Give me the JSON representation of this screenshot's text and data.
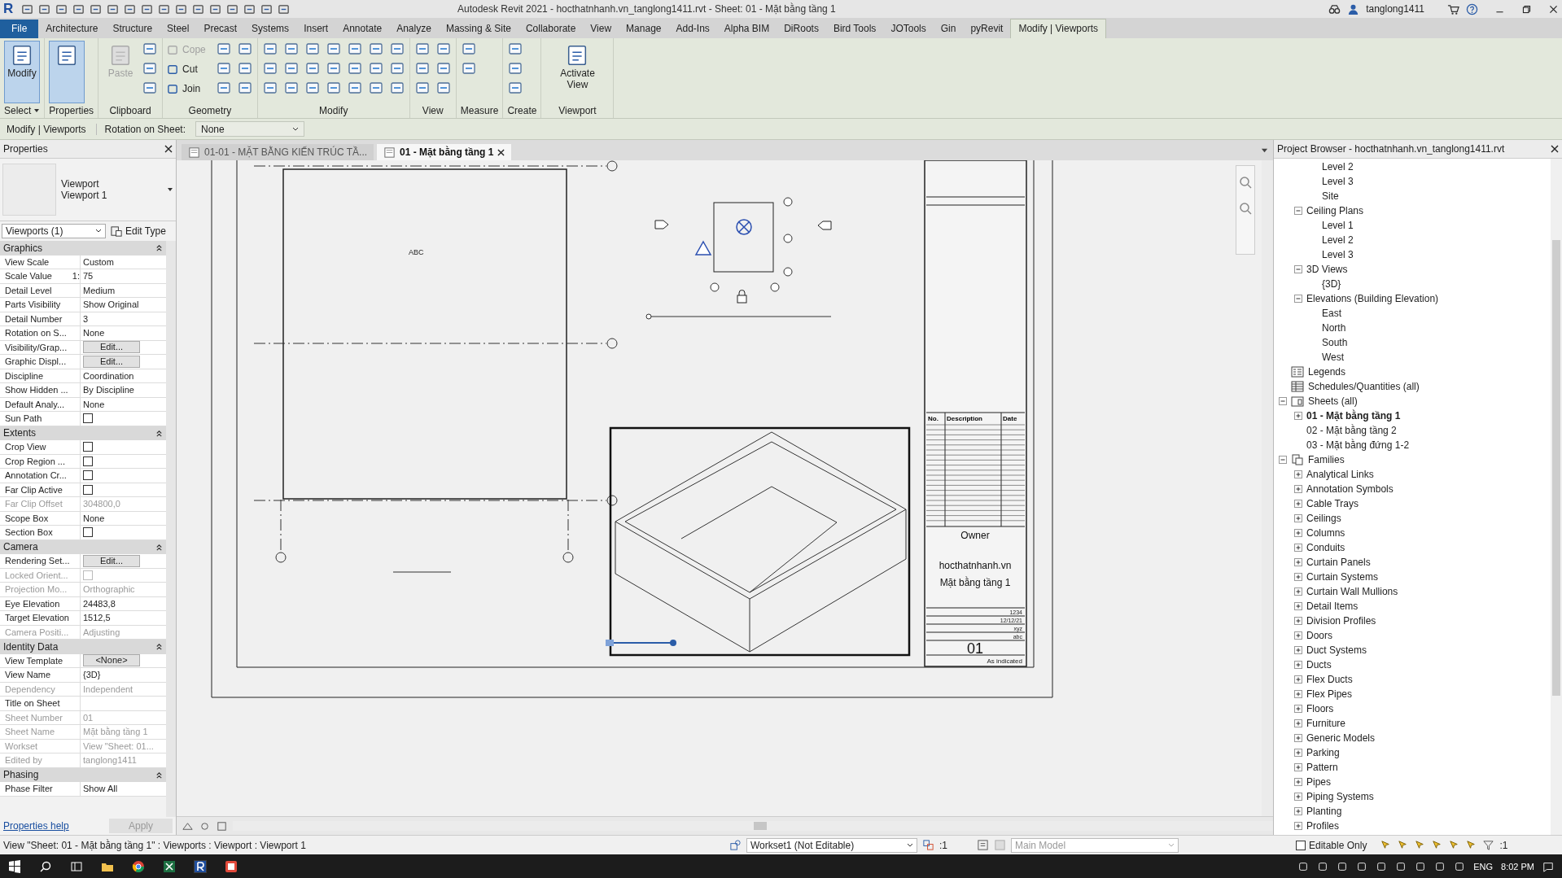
{
  "window": {
    "app_logo": "R",
    "title": "Autodesk Revit 2021 - hocthatnhanh.vn_tanglong1411.rvt - Sheet: 01 - Mặt bằng tầng 1",
    "user": "tanglong1411"
  },
  "ribbon_tabs": [
    {
      "label": "File",
      "kind": "file",
      "selected": false
    },
    {
      "label": "Architecture",
      "kind": "tab",
      "selected": false
    },
    {
      "label": "Structure",
      "kind": "tab",
      "selected": false
    },
    {
      "label": "Steel",
      "kind": "tab",
      "selected": false
    },
    {
      "label": "Precast",
      "kind": "tab",
      "selected": false
    },
    {
      "label": "Systems",
      "kind": "tab",
      "selected": false
    },
    {
      "label": "Insert",
      "kind": "tab",
      "selected": false
    },
    {
      "label": "Annotate",
      "kind": "tab",
      "selected": false
    },
    {
      "label": "Analyze",
      "kind": "tab",
      "selected": false
    },
    {
      "label": "Massing & Site",
      "kind": "tab",
      "selected": false
    },
    {
      "label": "Collaborate",
      "kind": "tab",
      "selected": false
    },
    {
      "label": "View",
      "kind": "tab",
      "selected": false
    },
    {
      "label": "Manage",
      "kind": "tab",
      "selected": false
    },
    {
      "label": "Add-Ins",
      "kind": "tab",
      "selected": false
    },
    {
      "label": "Alpha BIM",
      "kind": "tab",
      "selected": false
    },
    {
      "label": "DiRoots",
      "kind": "tab",
      "selected": false
    },
    {
      "label": "Bird Tools",
      "kind": "tab",
      "selected": false
    },
    {
      "label": "JOTools",
      "kind": "tab",
      "selected": false
    },
    {
      "label": "Gin",
      "kind": "tab",
      "selected": false
    },
    {
      "label": "pyRevit",
      "kind": "tab",
      "selected": false
    },
    {
      "label": "Modify | Viewports",
      "kind": "tab",
      "selected": true
    }
  ],
  "ribbon_panels": [
    {
      "label": "Select",
      "dropdown": true,
      "tools": [
        {
          "kind": "large",
          "label": "Modify",
          "selected": true,
          "disabled": false
        }
      ]
    },
    {
      "label": "Properties",
      "tools": [
        {
          "kind": "large",
          "selected": true,
          "disabled": false
        }
      ]
    },
    {
      "label": "Clipboard",
      "tools": [
        {
          "kind": "large",
          "label": "Paste",
          "selected": false,
          "disabled": true
        },
        {
          "kind": "icon"
        },
        {
          "kind": "icon"
        },
        {
          "kind": "icon"
        }
      ]
    },
    {
      "label": "Geometry",
      "tools": [
        {
          "kind": "small",
          "label": "Cope",
          "disabled": true
        },
        {
          "kind": "small",
          "label": "Cut",
          "disabled": false
        },
        {
          "kind": "small",
          "label": "Join",
          "disabled": false
        },
        {
          "kind": "icon"
        },
        {
          "kind": "icon"
        },
        {
          "kind": "icon"
        },
        {
          "kind": "icon"
        },
        {
          "kind": "icon"
        },
        {
          "kind": "icon"
        }
      ]
    },
    {
      "label": "Modify",
      "tools": [
        {
          "kind": "icon"
        },
        {
          "kind": "icon"
        },
        {
          "kind": "icon"
        },
        {
          "kind": "icon"
        },
        {
          "kind": "icon"
        },
        {
          "kind": "icon"
        },
        {
          "kind": "icon"
        },
        {
          "kind": "icon"
        },
        {
          "kind": "icon"
        },
        {
          "kind": "icon"
        },
        {
          "kind": "icon"
        },
        {
          "kind": "icon"
        },
        {
          "kind": "icon"
        },
        {
          "kind": "icon"
        },
        {
          "kind": "icon"
        },
        {
          "kind": "icon"
        },
        {
          "kind": "icon"
        },
        {
          "kind": "icon"
        },
        {
          "kind": "icon"
        },
        {
          "kind": "icon"
        },
        {
          "kind": "icon"
        }
      ]
    },
    {
      "label": "View",
      "tools": [
        {
          "kind": "icon"
        },
        {
          "kind": "icon"
        },
        {
          "kind": "icon"
        },
        {
          "kind": "icon"
        },
        {
          "kind": "icon"
        },
        {
          "kind": "icon"
        }
      ]
    },
    {
      "label": "Measure",
      "tools": [
        {
          "kind": "icon"
        },
        {
          "kind": "icon"
        }
      ]
    },
    {
      "label": "Create",
      "tools": [
        {
          "kind": "icon"
        },
        {
          "kind": "icon"
        },
        {
          "kind": "icon"
        }
      ]
    },
    {
      "label": "Viewport",
      "tools": [
        {
          "kind": "large",
          "label": "Activate View",
          "selected": false,
          "disabled": false
        }
      ]
    }
  ],
  "options_bar": {
    "context": "Modify | Viewports",
    "rotation_label": "Rotation on Sheet:",
    "rotation_value": "None"
  },
  "properties": {
    "title": "Properties",
    "type_name": "Viewport",
    "type_subname": "Viewport 1",
    "selector": "Viewports (1)",
    "edit_type": "Edit Type",
    "sections": [
      {
        "label": "Graphics",
        "rows": [
          {
            "label": "View Scale",
            "value": "Custom",
            "kind": "text",
            "disabled": false
          },
          {
            "label": "Scale Value",
            "suffix": "1:",
            "value": "75",
            "kind": "text",
            "disabled": false
          },
          {
            "label": "Detail Level",
            "value": "Medium",
            "kind": "text",
            "disabled": false
          },
          {
            "label": "Parts Visibility",
            "value": "Show Original",
            "kind": "text",
            "disabled": false
          },
          {
            "label": "Detail Number",
            "value": "3",
            "kind": "text",
            "disabled": false
          },
          {
            "label": "Rotation on S...",
            "value": "None",
            "kind": "text",
            "disabled": false
          },
          {
            "label": "Visibility/Grap...",
            "value": "Edit...",
            "kind": "button",
            "disabled": false
          },
          {
            "label": "Graphic Displ...",
            "value": "Edit...",
            "kind": "button",
            "disabled": false
          },
          {
            "label": "Discipline",
            "value": "Coordination",
            "kind": "text",
            "disabled": false
          },
          {
            "label": "Show Hidden ...",
            "value": "By Discipline",
            "kind": "text",
            "disabled": false
          },
          {
            "label": "Default Analy...",
            "value": "None",
            "kind": "text",
            "disabled": false
          },
          {
            "label": "Sun Path",
            "kind": "checkbox",
            "checked": false,
            "disabled": false
          }
        ]
      },
      {
        "label": "Extents",
        "rows": [
          {
            "label": "Crop View",
            "kind": "checkbox",
            "checked": false,
            "disabled": false
          },
          {
            "label": "Crop Region ...",
            "kind": "checkbox",
            "checked": false,
            "disabled": false
          },
          {
            "label": "Annotation Cr...",
            "kind": "checkbox",
            "checked": false,
            "disabled": false
          },
          {
            "label": "Far Clip Active",
            "kind": "checkbox",
            "checked": false,
            "disabled": false
          },
          {
            "label": "Far Clip Offset",
            "value": "304800,0",
            "kind": "text",
            "disabled": true
          },
          {
            "label": "Scope Box",
            "value": "None",
            "kind": "text",
            "disabled": false
          },
          {
            "label": "Section Box",
            "kind": "checkbox",
            "checked": false,
            "disabled": false
          }
        ]
      },
      {
        "label": "Camera",
        "rows": [
          {
            "label": "Rendering Set...",
            "value": "Edit...",
            "kind": "button",
            "disabled": false
          },
          {
            "label": "Locked Orient...",
            "kind": "checkbox",
            "checked": false,
            "disabled": true
          },
          {
            "label": "Projection Mo...",
            "value": "Orthographic",
            "kind": "text",
            "disabled": true
          },
          {
            "label": "Eye Elevation",
            "value": "24483,8",
            "kind": "text",
            "disabled": false
          },
          {
            "label": "Target Elevation",
            "value": "1512,5",
            "kind": "text",
            "disabled": false
          },
          {
            "label": "Camera Positi...",
            "value": "Adjusting",
            "kind": "text",
            "disabled": true
          }
        ]
      },
      {
        "label": "Identity Data",
        "rows": [
          {
            "label": "View Template",
            "value": "<None>",
            "kind": "button",
            "disabled": false
          },
          {
            "label": "View Name",
            "value": "{3D}",
            "kind": "text",
            "disabled": false
          },
          {
            "label": "Dependency",
            "value": "Independent",
            "kind": "text",
            "disabled": true
          },
          {
            "label": "Title on Sheet",
            "kind": "text",
            "disabled": false
          },
          {
            "label": "Sheet Number",
            "value": "01",
            "kind": "text",
            "disabled": true
          },
          {
            "label": "Sheet Name",
            "value": "Mặt bằng tầng 1",
            "kind": "text",
            "disabled": true
          },
          {
            "label": "Workset",
            "value": "View \"Sheet: 01...",
            "kind": "text",
            "disabled": true
          },
          {
            "label": "Edited by",
            "value": "tanglong1411",
            "kind": "text",
            "disabled": true
          }
        ]
      },
      {
        "label": "Phasing",
        "rows": [
          {
            "label": "Phase Filter",
            "value": "Show All",
            "kind": "text",
            "disabled": false
          }
        ]
      }
    ],
    "help_link": "Properties help",
    "apply": "Apply"
  },
  "view_tabs": [
    {
      "label": "01-01 - MẶT BẰNG KIẾN TRÚC TẦ...",
      "selected": false
    },
    {
      "label": "01 - Mặt bằng tầng 1",
      "selected": true
    }
  ],
  "sheet": {
    "viewport_label": "ABC",
    "title_block": {
      "revision_headers": [
        "No.",
        "Description",
        "Date"
      ],
      "owner": "Owner",
      "project": "hocthatnhanh.vn",
      "sheet_name": "Mặt bằng tầng 1",
      "fields": [
        "1234",
        "12/12/21",
        "xyz",
        "abc"
      ],
      "sheet_number": "01",
      "scale": "As indicated"
    }
  },
  "project_browser": {
    "title": "Project Browser - hocthatnhanh.vn_tanglong1411.rvt",
    "tree": [
      {
        "children": [
          {
            "children": [
              {
                "label": "Level 2"
              },
              {
                "label": "Level 3"
              },
              {
                "label": "Site"
              }
            ]
          },
          {
            "label": "Ceiling Plans",
            "expanded": true,
            "children": [
              {
                "label": "Level 1"
              },
              {
                "label": "Level 2"
              },
              {
                "label": "Level 3"
              }
            ]
          },
          {
            "label": "3D Views",
            "expanded": true,
            "children": [
              {
                "label": "{3D}"
              }
            ]
          },
          {
            "label": "Elevations (Building Elevation)",
            "expanded": true,
            "children": [
              {
                "label": "East"
              },
              {
                "label": "North"
              },
              {
                "label": "South"
              },
              {
                "label": "West"
              }
            ]
          }
        ]
      },
      {
        "label": "Legends",
        "kind": "legend"
      },
      {
        "label": "Schedules/Quantities (all)",
        "kind": "schedule"
      },
      {
        "label": "Sheets (all)",
        "kind": "sheet",
        "expanded": true,
        "children": [
          {
            "label": "01 - Mặt bằng tầng 1",
            "expanded": false,
            "selected": true
          },
          {
            "label": "02 - Mặt bằng tầng 2",
            "selected": false
          },
          {
            "label": "03 - Mặt bằng đứng 1-2",
            "selected": false
          }
        ]
      },
      {
        "label": "Families",
        "kind": "family",
        "expanded": true,
        "children": [
          {
            "label": "Analytical Links",
            "expanded": false
          },
          {
            "label": "Annotation Symbols",
            "expanded": false
          },
          {
            "label": "Cable Trays",
            "expanded": false
          },
          {
            "label": "Ceilings",
            "expanded": false
          },
          {
            "label": "Columns",
            "expanded": false
          },
          {
            "label": "Conduits",
            "expanded": false
          },
          {
            "label": "Curtain Panels",
            "expanded": false
          },
          {
            "label": "Curtain Systems",
            "expanded": false
          },
          {
            "label": "Curtain Wall Mullions",
            "expanded": false
          },
          {
            "label": "Detail Items",
            "expanded": false
          },
          {
            "label": "Division Profiles",
            "expanded": false
          },
          {
            "label": "Doors",
            "expanded": false
          },
          {
            "label": "Duct Systems",
            "expanded": false
          },
          {
            "label": "Ducts",
            "expanded": false
          },
          {
            "label": "Flex Ducts",
            "expanded": false
          },
          {
            "label": "Flex Pipes",
            "expanded": false
          },
          {
            "label": "Floors",
            "expanded": false
          },
          {
            "label": "Furniture",
            "expanded": false
          },
          {
            "label": "Generic Models",
            "expanded": false
          },
          {
            "label": "Parking",
            "expanded": false
          },
          {
            "label": "Pattern",
            "expanded": false
          },
          {
            "label": "Pipes",
            "expanded": false
          },
          {
            "label": "Piping Systems",
            "expanded": false
          },
          {
            "label": "Planting",
            "expanded": false
          },
          {
            "label": "Profiles",
            "expanded": false
          }
        ]
      }
    ]
  },
  "status_bar": {
    "message": "View \"Sheet: 01 - Mặt bằng tầng 1\" : Viewports : Viewport : Viewport 1",
    "workset": "Workset1 (Not Editable)",
    "editable_count": ":1",
    "design_option": "Main Model",
    "editable_only": {
      "label": "Editable Only",
      "checked": false
    },
    "filter_count": ":1"
  },
  "taskbar": {
    "language": "ENG",
    "time": "8:02 PM"
  }
}
